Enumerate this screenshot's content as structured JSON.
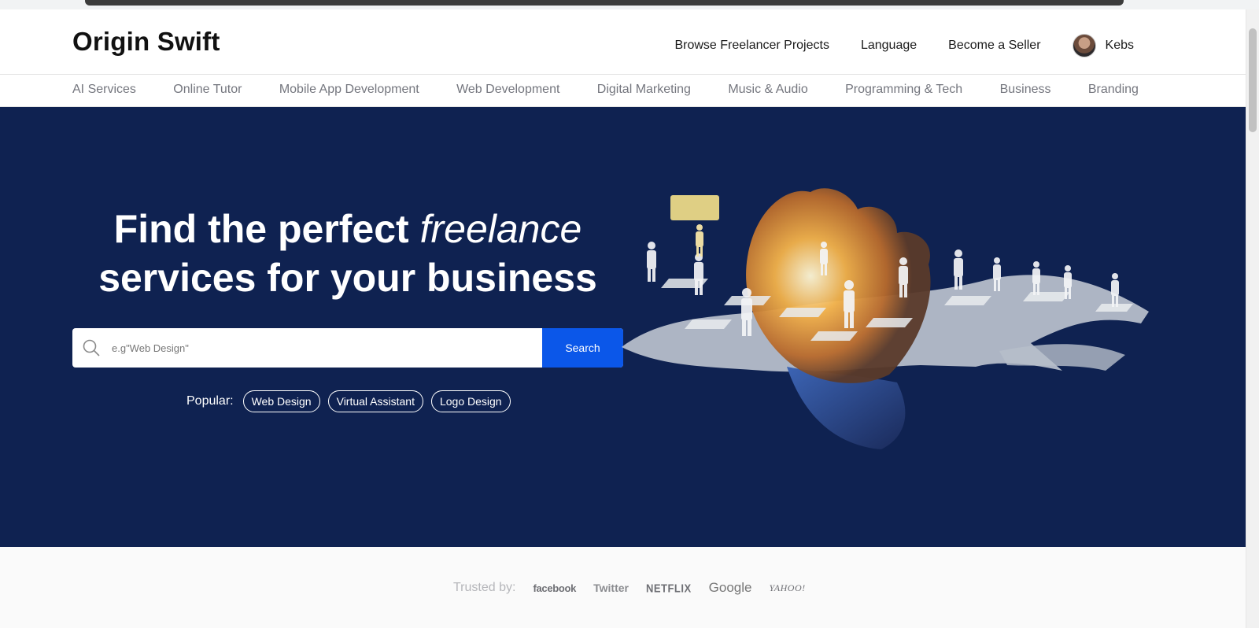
{
  "header": {
    "logo": "Origin Swift",
    "nav": [
      {
        "label": "Browse Freelancer Projects"
      },
      {
        "label": "Language"
      },
      {
        "label": "Become a Seller"
      }
    ],
    "user": {
      "name": "Kebs"
    }
  },
  "categories": [
    "AI Services",
    "Online Tutor",
    "Mobile App Development",
    "Web Development",
    "Digital Marketing",
    "Music & Audio",
    "Programming & Tech",
    "Business",
    "Branding"
  ],
  "hero": {
    "title_line1_prefix": "Find the perfect",
    "title_line1_emphasis": "freelance",
    "title_line2": "services for your business",
    "search": {
      "placeholder": "e.g\"Web Design\"",
      "button_label": "Search"
    },
    "popular": {
      "label": "Popular:",
      "tags": [
        "Web Design",
        "Virtual Assistant",
        "Logo Design"
      ]
    },
    "background_color": "#0f2251",
    "accent_color": "#0b57e9"
  },
  "trusted": {
    "label": "Trusted by:",
    "brands": [
      "facebook",
      "Twitter",
      "NETFLIX",
      "Google",
      "YAHOO!"
    ]
  }
}
